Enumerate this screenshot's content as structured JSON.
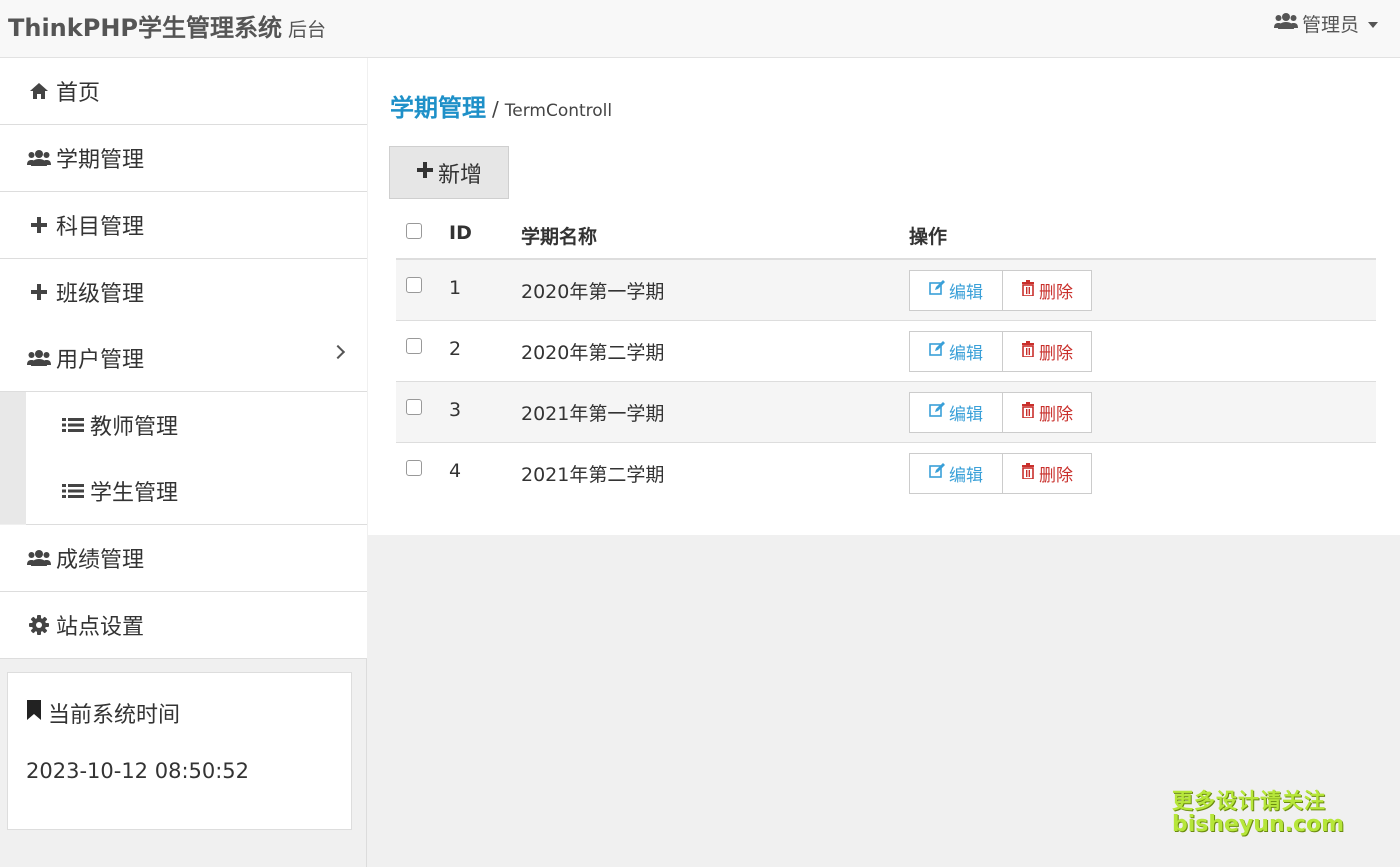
{
  "header": {
    "brand": "ThinkPHP学生管理系统",
    "brand_sub": "后台",
    "user_label": "管理员"
  },
  "sidebar": {
    "items": [
      {
        "label": "首页",
        "icon": "home-icon"
      },
      {
        "label": "学期管理",
        "icon": "users-icon"
      },
      {
        "label": "科目管理",
        "icon": "plus-icon"
      },
      {
        "label": "班级管理",
        "icon": "plus-icon"
      },
      {
        "label": "用户管理",
        "icon": "users-icon"
      },
      {
        "label": "教师管理",
        "icon": "list-icon"
      },
      {
        "label": "学生管理",
        "icon": "list-icon"
      },
      {
        "label": "成绩管理",
        "icon": "users-icon"
      },
      {
        "label": "站点设置",
        "icon": "gear-icon"
      }
    ],
    "time_panel": {
      "title": "当前系统时间",
      "value": "2023-10-12 08:50:52"
    }
  },
  "main": {
    "title": "学期管理",
    "separator": "/",
    "subtitle": "TermControll",
    "add_label": "新增",
    "table": {
      "headers": [
        "ID",
        "学期名称",
        "操作"
      ],
      "edit_label": "编辑",
      "delete_label": "删除",
      "rows": [
        {
          "id": "1",
          "name": "2020年第一学期"
        },
        {
          "id": "2",
          "name": "2020年第二学期"
        },
        {
          "id": "3",
          "name": "2021年第一学期"
        },
        {
          "id": "4",
          "name": "2021年第二学期"
        }
      ]
    }
  },
  "watermark": {
    "line1": "更多设计请关注",
    "line2": "bisheyun.com"
  },
  "colors": {
    "accent": "#1e90c8",
    "edit": "#3aa0d8",
    "delete": "#c9302c"
  }
}
